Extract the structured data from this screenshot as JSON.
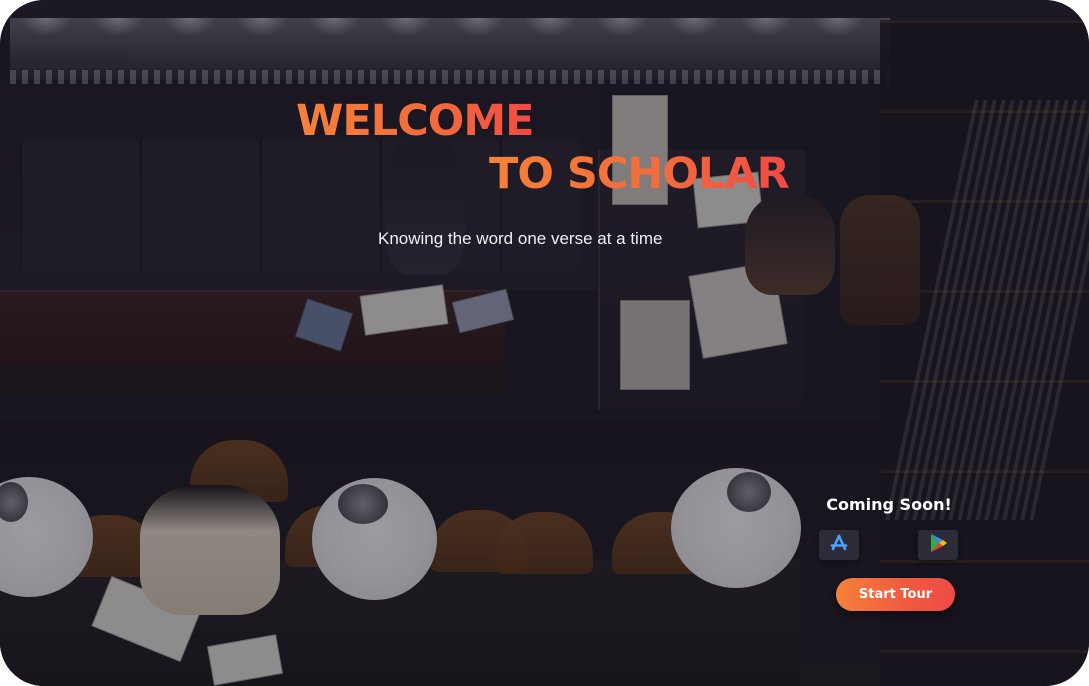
{
  "hero": {
    "title_line1": "WELCOME",
    "title_line2": "TO SCHOLAR",
    "tagline": "Knowing the word one verse at a time"
  },
  "download": {
    "heading": "Coming Soon!",
    "stores": [
      {
        "icon": "app-store-icon"
      },
      {
        "icon": "google-play-icon"
      }
    ]
  },
  "cta": {
    "label": "Start Tour"
  },
  "theme": {
    "accent_start": "#f5813a",
    "accent_end": "#ee4a47",
    "store_button_bg": "#2e2b39",
    "text_light": "#ffffff"
  }
}
